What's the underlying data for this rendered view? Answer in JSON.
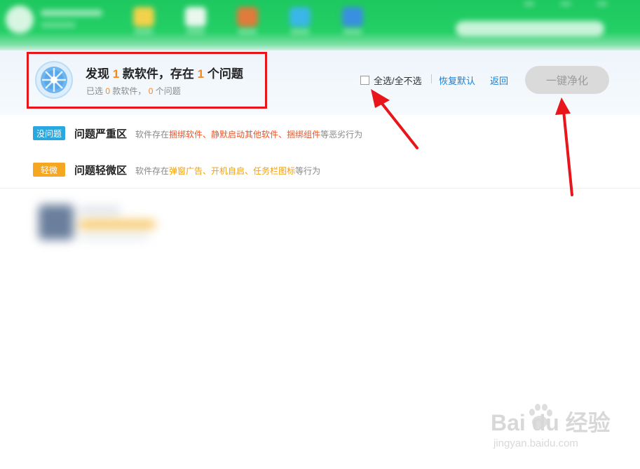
{
  "summary": {
    "title_prefix": "发现 ",
    "software_count": "1",
    "title_middle": " 款软件，存在 ",
    "problem_count": "1",
    "title_suffix": " 个问题",
    "sub_prefix": "已选 ",
    "selected_software": "0",
    "sub_middle": " 款软件， ",
    "selected_problems": "0",
    "sub_suffix": " 个问题"
  },
  "toolbar": {
    "select_all_label": "全选/全不选",
    "restore_default_label": "恢复默认",
    "back_label": "返回",
    "clean_button_label": "一键净化"
  },
  "rows": [
    {
      "badge": "没问题",
      "badge_color": "#2ba7e0",
      "title": "问题严重区",
      "desc_prefix": "软件存在",
      "hl1": "捆绑软件",
      "sep1": "、",
      "hl2": "静默启动其他软件",
      "sep2": "、",
      "hl3": "捆绑组件",
      "desc_suffix": "等恶劣行为"
    },
    {
      "badge": "轻微",
      "badge_color": "#f5a623",
      "title": "问题轻微区",
      "desc_prefix": "软件存在",
      "hl1": "弹窗广告",
      "sep1": "、",
      "hl2": "开机自启",
      "sep2": "、",
      "hl3": "任务栏图标",
      "desc_suffix": "等行为"
    }
  ],
  "watermark": {
    "brand": "Bai  du 经验",
    "url": "jingyan.baidu.com"
  },
  "colors": {
    "accent_orange": "#f7861e",
    "link_blue": "#1b7fd4",
    "annotation_red": "#e8151b",
    "header_green": "#1ec860"
  }
}
